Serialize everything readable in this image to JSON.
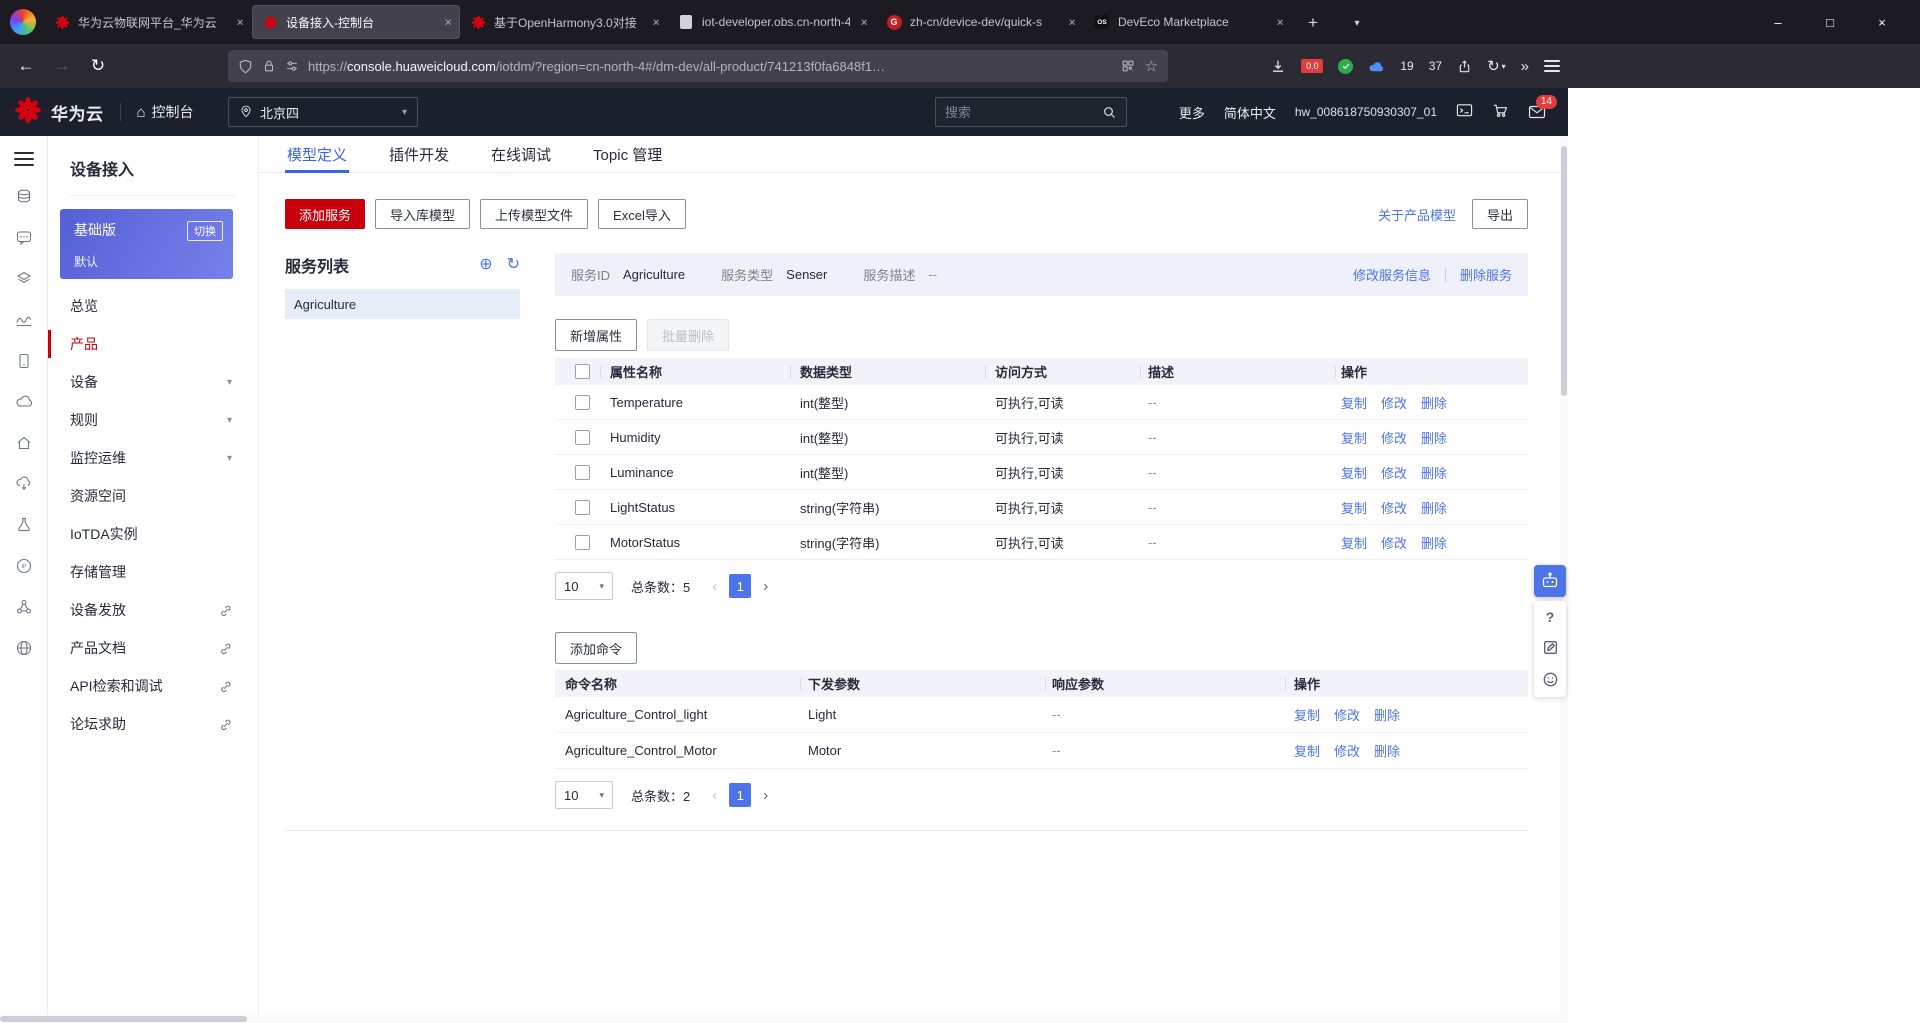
{
  "colors": {
    "brand_red": "#c7000b",
    "accent_blue": "#3d63e8",
    "link_blue": "#4d74e8",
    "console_header_bg": "#1b202c",
    "selected_item_bg": "#e8edfa",
    "edition_card_blue": "#5a64d8"
  },
  "icons": {
    "back": "←",
    "forward": "→",
    "reload": "↻",
    "star": "☆",
    "overflow": "»",
    "minimize": "–",
    "maximize": "□",
    "close": "×",
    "new_tab": "+",
    "tabs_dropdown": "▾",
    "tab_close": "×",
    "chevron_down": "▾",
    "home": "⌂",
    "plus_circle": "⊕",
    "refresh": "↻",
    "page_prev": "‹",
    "page_next": "›",
    "question": "?"
  },
  "browser": {
    "tabs": [
      {
        "title": "华为云物联网平台_华为云"
      },
      {
        "title": "设备接入-控制台"
      },
      {
        "title": "基于OpenHarmony3.0对接"
      },
      {
        "title": "iot-developer.obs.cn-north-4…"
      },
      {
        "title": "zh-cn/device-dev/quick-s"
      },
      {
        "title": "DevEco Marketplace"
      }
    ],
    "gitee_letter": "G",
    "deveco_letter": "OS",
    "url_protocol": "https://",
    "url_host": "console.huaweicloud.com",
    "url_path": "/iotdm/?region=cn-north-4#/dm-dev/all-product/741213f0fa6848f1…",
    "badges": {
      "shield_blocked": "0.0",
      "ext_count_1": "19",
      "ext_count_2": "37"
    }
  },
  "console_header": {
    "brand": "华为云",
    "console_label": "控制台",
    "region": "北京四",
    "search_placeholder": "搜索",
    "more": "更多",
    "language": "简体中文",
    "username": "hw_008618750930307_01",
    "mail_badge": "14"
  },
  "sidebar": {
    "title": "设备接入",
    "edition": {
      "name": "基础版",
      "switch_label": "切换",
      "sub": "默认"
    },
    "items": [
      {
        "label": "总览"
      },
      {
        "label": "产品"
      },
      {
        "label": "设备"
      },
      {
        "label": "规则"
      },
      {
        "label": "监控运维"
      },
      {
        "label": "资源空间"
      },
      {
        "label": "IoTDA实例"
      },
      {
        "label": "存储管理"
      },
      {
        "label": "设备发放"
      },
      {
        "label": "产品文档"
      },
      {
        "label": "API检索和调试"
      },
      {
        "label": "论坛求助"
      }
    ]
  },
  "main": {
    "tabs": [
      "模型定义",
      "插件开发",
      "在线调试",
      "Topic 管理"
    ],
    "actions": {
      "add_service": "添加服务",
      "import_model": "导入库模型",
      "upload_model": "上传模型文件",
      "excel_import": "Excel导入",
      "about_link": "关于产品模型",
      "export": "导出"
    },
    "service_list": {
      "title": "服务列表",
      "items": [
        "Agriculture"
      ]
    },
    "service_info": {
      "id_label": "服务ID",
      "id": "Agriculture",
      "type_label": "服务类型",
      "type": "Senser",
      "desc_label": "服务描述",
      "desc": "--",
      "modify": "修改服务信息",
      "delete": "删除服务"
    },
    "ops": [
      "复制",
      "修改",
      "删除"
    ],
    "properties": {
      "add": "新增属性",
      "batch_delete": "批量删除",
      "headers": [
        "属性名称",
        "数据类型",
        "访问方式",
        "描述",
        "操作"
      ],
      "rows": [
        {
          "name": "Temperature",
          "type": "int(整型)",
          "access": "可执行,可读",
          "desc": "--"
        },
        {
          "name": "Humidity",
          "type": "int(整型)",
          "access": "可执行,可读",
          "desc": "--"
        },
        {
          "name": "Luminance",
          "type": "int(整型)",
          "access": "可执行,可读",
          "desc": "--"
        },
        {
          "name": "LightStatus",
          "type": "string(字符串)",
          "access": "可执行,可读",
          "desc": "--"
        },
        {
          "name": "MotorStatus",
          "type": "string(字符串)",
          "access": "可执行,可读",
          "desc": "--"
        }
      ],
      "pagination": {
        "page_size": "10",
        "total_label": "总条数：",
        "total": "5",
        "page": "1"
      }
    },
    "commands": {
      "add": "添加命令",
      "headers": [
        "命令名称",
        "下发参数",
        "响应参数",
        "操作"
      ],
      "rows": [
        {
          "name": "Agriculture_Control_light",
          "param": "Light",
          "response": "--"
        },
        {
          "name": "Agriculture_Control_Motor",
          "param": "Motor",
          "response": "--"
        }
      ],
      "pagination": {
        "page_size": "10",
        "total_label": "总条数：",
        "total": "2",
        "page": "1"
      }
    }
  }
}
